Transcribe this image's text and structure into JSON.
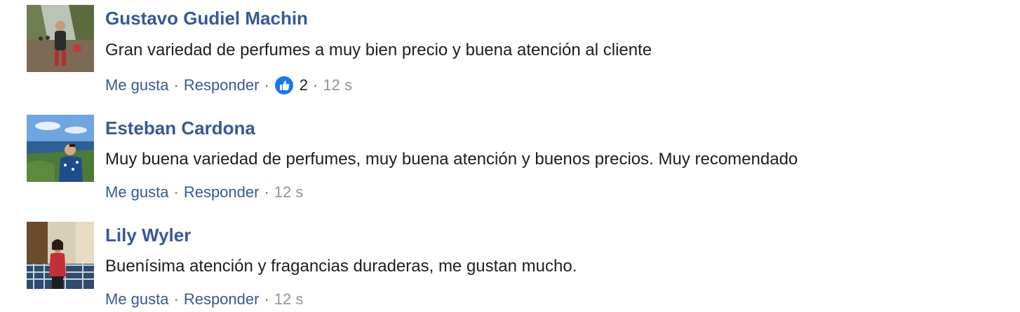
{
  "comments": [
    {
      "author": "Gustavo Gudiel Machin",
      "text": "Gran variedad de perfumes a muy bien precio y buena atención al cliente",
      "like_label": "Me gusta",
      "reply_label": "Responder",
      "reaction_icon": "thumbs-up-icon",
      "reaction_count": "2",
      "time": "12 s"
    },
    {
      "author": "Esteban Cardona",
      "text": "Muy buena variedad de perfumes, muy buena atención y buenos precios. Muy recomendado",
      "like_label": "Me gusta",
      "reply_label": "Responder",
      "time": "12 s"
    },
    {
      "author": "Lily Wyler",
      "text": "Buenísima atención y fragancias duraderas, me gustan mucho.",
      "like_label": "Me gusta",
      "reply_label": "Responder",
      "time": "12 s"
    }
  ],
  "colors": {
    "link": "#385898",
    "text": "#1c1e21",
    "meta": "#90949c",
    "like_blue": "#1877f2"
  }
}
